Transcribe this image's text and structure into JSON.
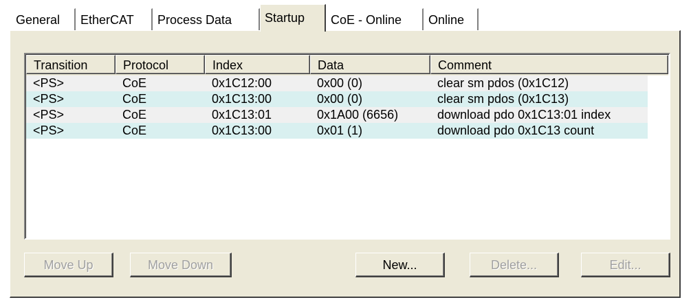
{
  "tabs": [
    {
      "label": "General"
    },
    {
      "label": "EtherCAT"
    },
    {
      "label": "Process Data"
    },
    {
      "label": "Startup"
    },
    {
      "label": "CoE - Online"
    },
    {
      "label": "Online"
    }
  ],
  "active_tab": "Startup",
  "list": {
    "columns": [
      "Transition",
      "Protocol",
      "Index",
      "Data",
      "Comment"
    ],
    "rows": [
      [
        "<PS>",
        "CoE",
        "0x1C12:00",
        "0x00 (0)",
        "clear sm pdos (0x1C12)"
      ],
      [
        "<PS>",
        "CoE",
        "0x1C13:00",
        "0x00 (0)",
        "clear sm pdos (0x1C13)"
      ],
      [
        "<PS>",
        "CoE",
        "0x1C13:01",
        "0x1A00 (6656)",
        "download pdo 0x1C13:01 index"
      ],
      [
        "<PS>",
        "CoE",
        "0x1C13:00",
        "0x01 (1)",
        "download pdo 0x1C13 count"
      ]
    ]
  },
  "buttons": {
    "move_up": {
      "label": "Move Up",
      "enabled": false
    },
    "move_down": {
      "label": "Move Down",
      "enabled": false
    },
    "new": {
      "label": "New...",
      "enabled": true
    },
    "delete": {
      "label": "Delete...",
      "enabled": false
    },
    "edit": {
      "label": "Edit...",
      "enabled": false
    }
  },
  "colors": {
    "panel": "#ece9d8",
    "row_odd": "#f0f0f0",
    "row_even": "#d9f0f0",
    "disabled_text": "#a0a0a0"
  }
}
